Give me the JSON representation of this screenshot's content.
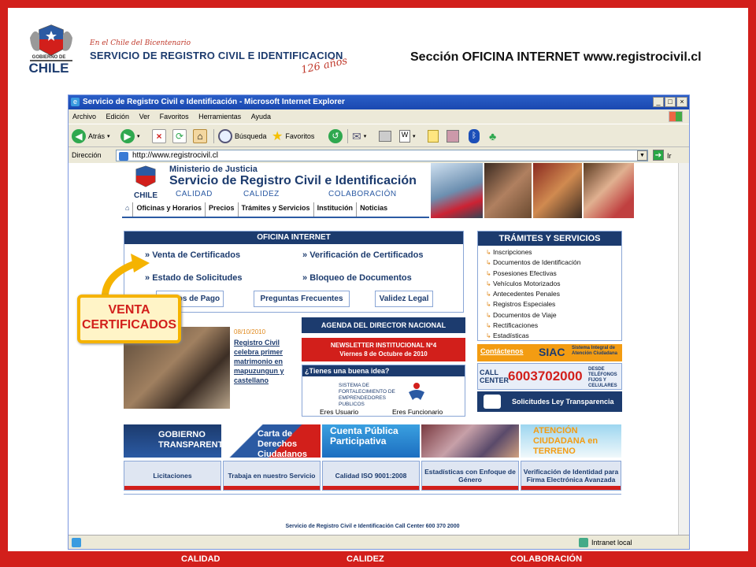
{
  "slide": {
    "bicentenario": "En el Chile del Bicentenario",
    "service": "SERVICIO DE REGISTRO CIVIL E IDENTIFICACION",
    "anios": "126 años",
    "logo_label": "GOBIERNO DE CHILE",
    "heading": "Sección OFICINA INTERNET www.registrocivil.cl",
    "callout_line1": "VENTA",
    "callout_line2": "CERTIFICADOS",
    "bottom": [
      "CALIDAD",
      "CALIDEZ",
      "COLABORACIÓN"
    ]
  },
  "browser": {
    "title": "Servicio de Registro Civil e Identificación - Microsoft Internet Explorer",
    "menu": [
      "Archivo",
      "Edición",
      "Ver",
      "Favoritos",
      "Herramientas",
      "Ayuda"
    ],
    "back": "Atrás",
    "search": "Búsqueda",
    "favorites": "Favoritos",
    "address_label": "Dirección",
    "url": "http://www.registrocivil.cl",
    "go": "Ir",
    "status": "Intranet local"
  },
  "site": {
    "ministry": "Ministerio de Justicia",
    "name": "Servicio de Registro Civil e Identificación",
    "mottos": [
      "CALIDAD",
      "CALIDEZ",
      "COLABORACIÓN"
    ],
    "nav": [
      "Oficinas y Horarios",
      "Precios",
      "Trámites y Servicios",
      "Institución",
      "Noticias"
    ],
    "oficina": {
      "title": "OFICINA INTERNET",
      "links": [
        "Venta de Certificados",
        "Verificación de Certificados",
        "Estado de Solicitudes",
        "Bloqueo de Documentos"
      ],
      "buttons": [
        "Medios de Pago",
        "Preguntas Frecuentes",
        "Validez Legal"
      ]
    },
    "tramites": {
      "title": "TRÁMITES Y SERVICIOS",
      "items": [
        "Inscripciones",
        "Documentos de Identificación",
        "Posesiones Efectivas",
        "Vehículos Motorizados",
        "Antecedentes Penales",
        "Registros Especiales",
        "Documentos de Viaje",
        "Rectificaciones",
        "Estadísticas"
      ]
    },
    "news": {
      "date": "08/10/2010",
      "text": "Registro Civil celebra primer matrimonio en mapuzungun y castellano"
    },
    "agenda": "AGENDA DEL DIRECTOR NACIONAL",
    "newsletter_1": "NEWSLETTER INSTITUCIONAL Nº4",
    "newsletter_2": "Viernes 8 de Octubre de 2010",
    "idea": {
      "title": "¿Tienes una buena idea?",
      "program": "SISTEMA DE FORTALECIMIENTO DE EMPRENDEDORES PUBLICOS",
      "user": "Eres Usuario",
      "official": "Eres Funcionario"
    },
    "contact": "Contáctenos",
    "siac": "SIAC",
    "siac_desc": "Sistema Integral de Atención Ciudadana",
    "call_label": "CALL CENTER",
    "call_number": "6003702000",
    "call_desc": "DESDE TELÉFONOS FIJOS Y CELULARES",
    "transparencia": "Solicitudes Ley Transparencia",
    "banners": [
      "GOBIERNO TRANSPARENTE",
      "Carta de Derechos Ciudadanos",
      "Cuenta Pública Participativa",
      "",
      "ATENCIÓN CIUDADANA en TERRENO"
    ],
    "tiles": [
      "Licitaciones",
      "Trabaja en nuestro Servicio",
      "Calidad ISO 9001:2008",
      "Estadísticas con Enfoque de Género",
      "Verificación de Identidad para Firma Electrónica Avanzada"
    ],
    "footer": "Servicio de Registro Civil e Identificación     Call Center 600 370 2000"
  },
  "colors": {
    "red": "#d21f1b",
    "navy": "#1c3b6e",
    "orange": "#f39c12",
    "callout": "#f5b300"
  }
}
